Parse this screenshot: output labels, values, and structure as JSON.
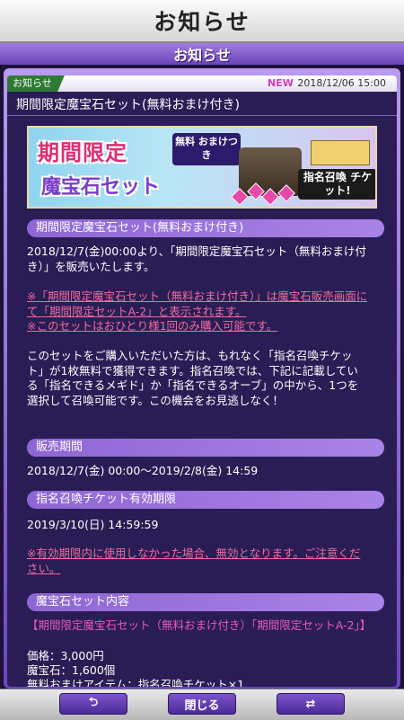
{
  "header": {
    "title": "お知らせ",
    "subtitle": "お知らせ"
  },
  "notice": {
    "category": "お知らせ",
    "new_badge": "NEW",
    "date": "2018/12/06 15:00",
    "heading": "期間限定魔宝石セット(無料おまけ付き)"
  },
  "banner": {
    "title_line1": "期間限定",
    "title_line2": "魔宝石セット",
    "badge": "無料 おまけつき",
    "ticket": "指名召喚 チケット!"
  },
  "sections": [
    {
      "title": "期間限定魔宝石セット(無料おまけ付き)"
    },
    {
      "title": "販売期間"
    },
    {
      "title": "指名召喚チケット有効期限"
    },
    {
      "title": "魔宝石セット内容"
    }
  ],
  "body": {
    "intro": "2018/12/7(金)00:00より、「期間限定魔宝石セット（無料おまけ付き）」を販売いたします。",
    "note1": "※「期間限定魔宝石セット（無料おまけ付き）」は魔宝石販売画面にて「期間限定セットA-2」と表示されます。",
    "note2": "※このセットはおひとり様1回のみ購入可能です。",
    "desc": "このセットをご購入いただいた方は、もれなく「指名召喚チケット」が1枚無料で獲得できます。指名召喚では、下記に記載している「指名できるメギド」か「指名できるオーブ」の中から、1つを選択して召喚可能です。この機会をお見逃しなく！",
    "sale_period": "2018/12/7(金) 00:00～2019/2/8(金) 14:59",
    "expiry": "2019/3/10(日) 14:59:59",
    "expiry_note": "※有効期限内に使用しなかった場合、無効となります。ご注意ください。",
    "set_name": "【期間限定魔宝石セット（無料おまけ付き）「期間限定セットA-2」】",
    "price": "価格：3,000円",
    "stones": "魔宝石：1,600個",
    "extra": "無料おまけアイテム：指名召喚チケット×1"
  },
  "footer": {
    "close": "閉じる"
  },
  "colors": {
    "accent": "#7d55c9",
    "link": "#f06a9c",
    "new": "#d23ab8",
    "category": "#2f7a33"
  }
}
